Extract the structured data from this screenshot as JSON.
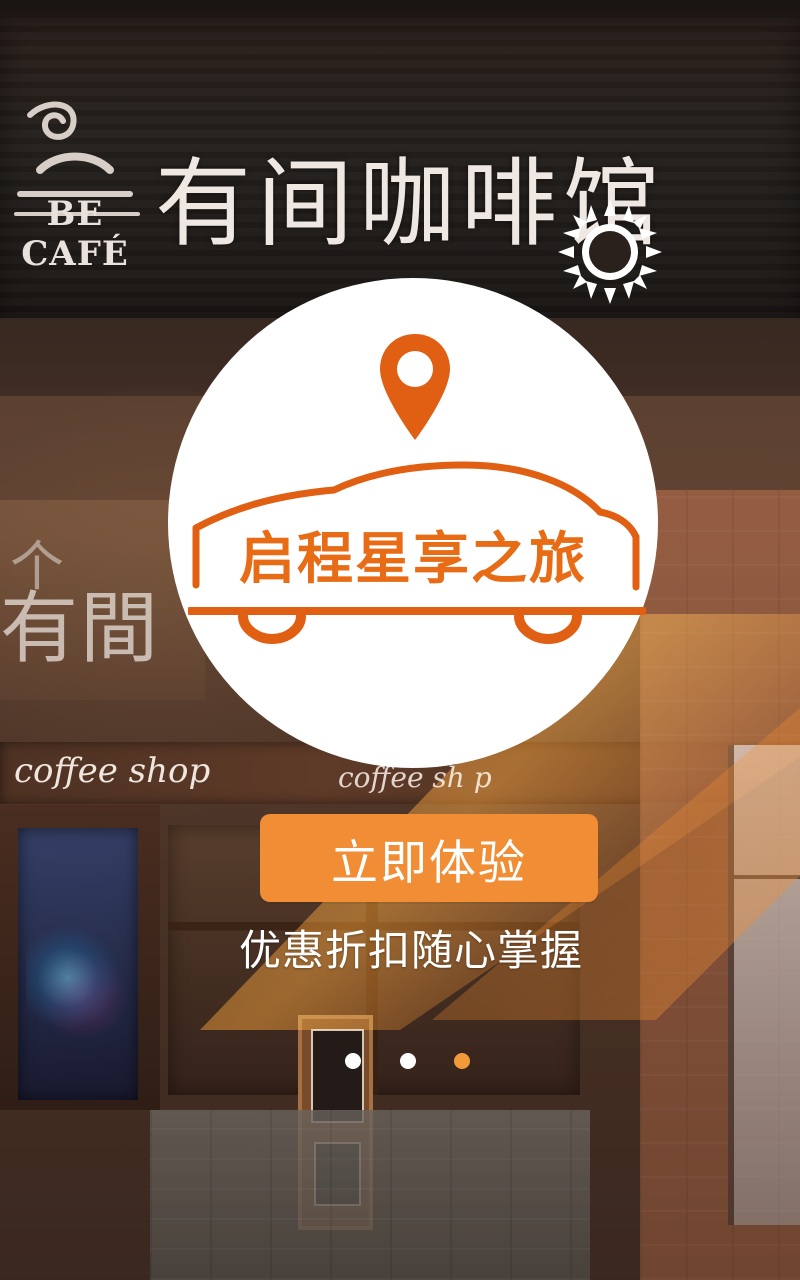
{
  "colors": {
    "accent": "#f08d35",
    "title": "#e86b16",
    "white": "#ffffff"
  },
  "background": {
    "sign_brand": "BE CAFÉ",
    "sign_title": "有间咖啡馆",
    "window_text_left": "有間",
    "window_top_char": "个",
    "coffee_text_left": "coffee shop",
    "coffee_text_center": "coffee sh p"
  },
  "hero": {
    "title": "启程星享之旅",
    "icons": {
      "sun": "sun-icon",
      "location": "location-pin-icon",
      "car": "car-outline-icon"
    }
  },
  "cta": {
    "label": "立即体验"
  },
  "subtitle": "优惠折扣随心掌握",
  "pager": {
    "current_page": 3,
    "total_pages": 3
  }
}
